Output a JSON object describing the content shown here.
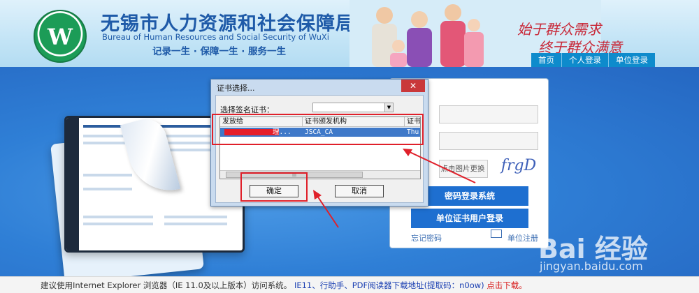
{
  "header": {
    "title_cn": "无锡市人力资源和社会保障局",
    "title_en": "Bureau of Human Resources and Social Security of WuXi",
    "slogan": "记录一生 · 保障一生 · 服务一生",
    "calligraphy_1": "始于群众需求",
    "calligraphy_2": "终于群众满意",
    "nav": [
      "首页",
      "个人登录",
      "单位登录"
    ]
  },
  "dialog": {
    "title": "证书选择...",
    "close_glyph": "✕",
    "select_label": "选择签名证书：",
    "columns": [
      "发放给",
      "证书颁发机构",
      "证书"
    ],
    "row": {
      "issued_to_tail": "理...",
      "issuer": "JSCA_CA",
      "date_start": "Thu"
    },
    "scroll_glyph": "|||",
    "confirm_label": "确定",
    "cancel_label": "取消"
  },
  "login": {
    "captcha_button": "点击图片更换",
    "captcha_text": "frgD",
    "password_login": "密码登录系统",
    "cert_login": "单位证书用户登录",
    "forgot": "忘记密码",
    "register": "单位注册"
  },
  "watermark": {
    "brand": "Bai 经验",
    "url": "jingyan.baidu.com"
  },
  "footer": {
    "notice": "建议使用Internet Explorer 浏览器（IE 11.0及以上版本）访问系统。",
    "downloads": "IE11、行助手、PDF阅读器下载地址(提取码：n0ow)",
    "link": "点击下载。"
  },
  "colors": {
    "accent_blue": "#1e6fd0",
    "highlight_red": "#e0202a",
    "title_blue": "#1e5aa8"
  }
}
